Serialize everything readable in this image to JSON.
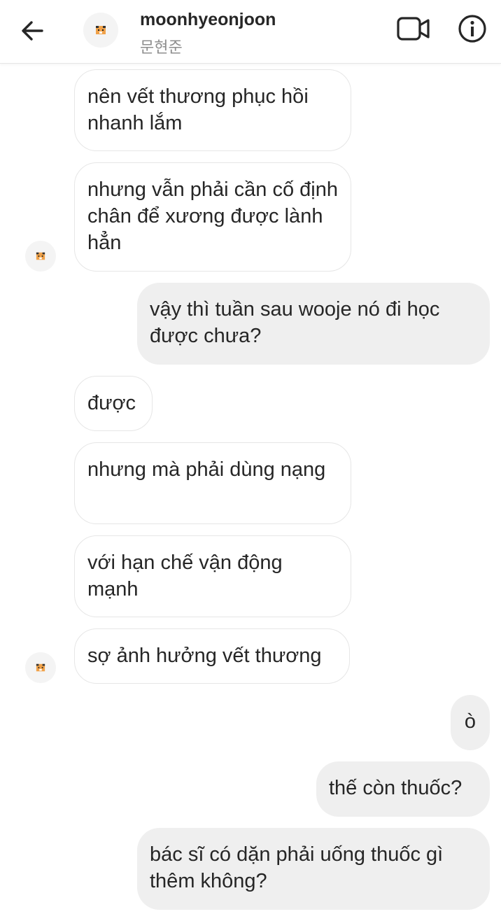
{
  "header": {
    "username": "moonhyeonjoon",
    "subtitle": "문현준",
    "icons": [
      "back-arrow-icon",
      "video-call-icon",
      "info-icon"
    ]
  },
  "messages": [
    {
      "from": "them",
      "text": "nên vết thương phục hồi nhanh lắm"
    },
    {
      "from": "them",
      "text": "nhưng vẫn phải cần cố định chân để xương được lành hẳn"
    },
    {
      "from": "me",
      "text": "vậy thì tuần sau wooje nó đi học được chưa?"
    },
    {
      "from": "them",
      "text": "được"
    },
    {
      "from": "them",
      "text": "nhưng mà phải dùng nạng"
    },
    {
      "from": "them",
      "text": "với hạn chế vận động mạnh"
    },
    {
      "from": "them",
      "text": "sợ ảnh hưởng vết thương"
    },
    {
      "from": "me",
      "text": "ò"
    },
    {
      "from": "me",
      "text": "thế còn thuốc?"
    },
    {
      "from": "me",
      "text": "bác sĩ có dặn phải uống thuốc gì thêm không?"
    }
  ],
  "colors": {
    "outgoing_bg": "#efefef",
    "incoming_border": "#e6e6e6",
    "text": "#262626",
    "subtle": "#8e8e8e"
  }
}
